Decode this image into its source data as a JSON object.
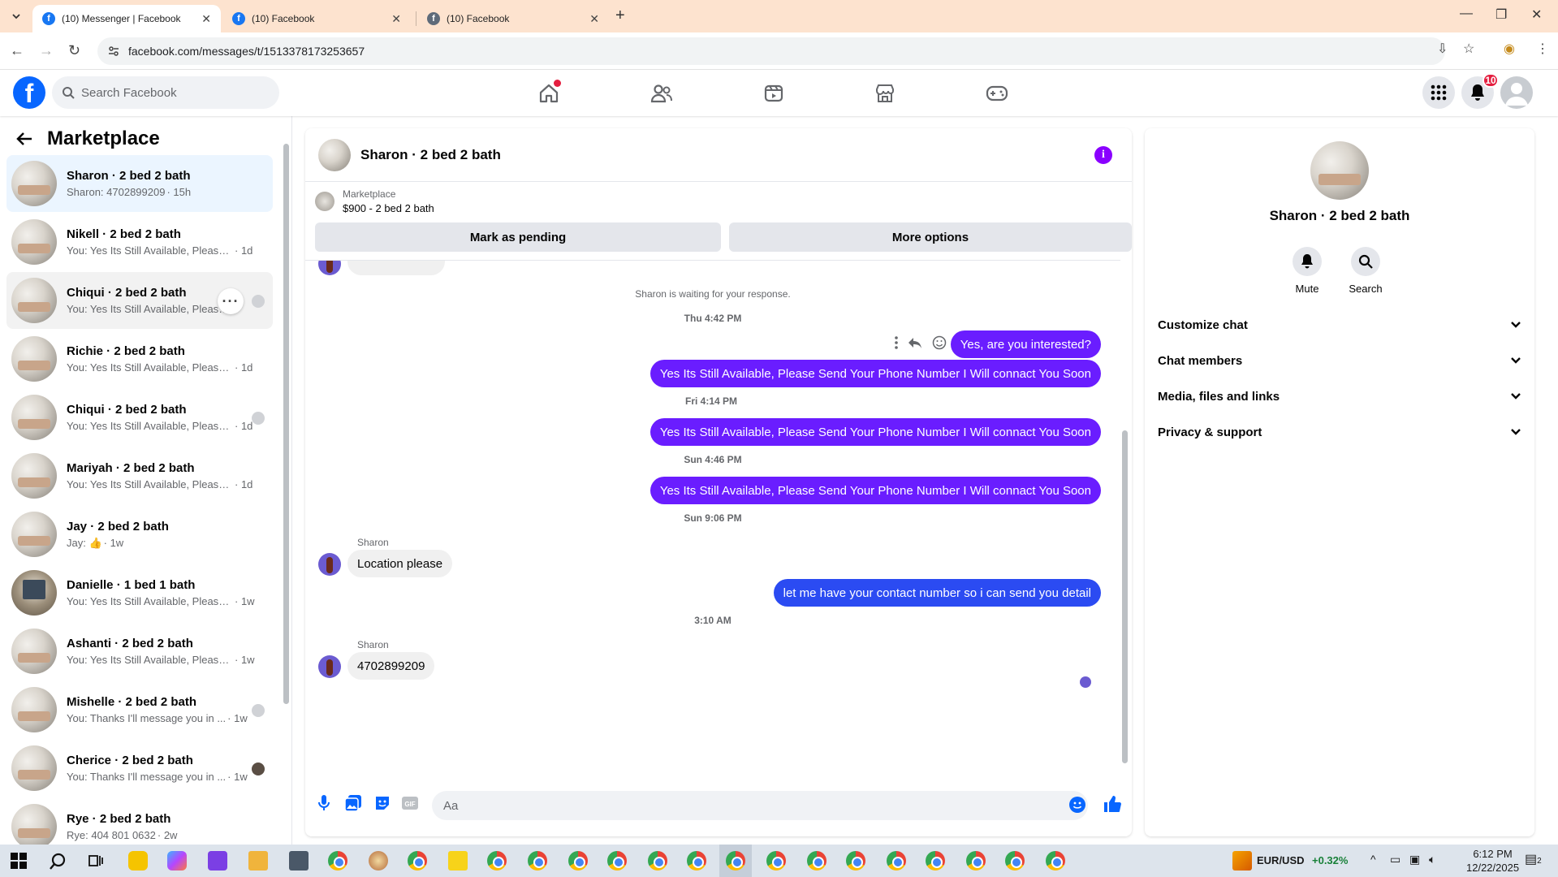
{
  "browser": {
    "tabs": [
      {
        "title": "(10) Messenger | Facebook",
        "active": true
      },
      {
        "title": "(10) Facebook",
        "active": false
      },
      {
        "title": "(10) Facebook",
        "active": false
      }
    ],
    "url": "facebook.com/messages/t/1513378173253657"
  },
  "fb": {
    "search_placeholder": "Search Facebook",
    "notif_count": "10",
    "brand_color": "#0866ff"
  },
  "sidebar": {
    "title": "Marketplace",
    "conversations": [
      {
        "name": "Sharon · 2 bed 2 bath",
        "preview": "Sharon: 4702899209",
        "time": "· 15h",
        "selected": true
      },
      {
        "name": "Nikell · 2 bed 2 bath",
        "preview": "You: Yes Its Still Available, Please Se...",
        "time": "· 1d"
      },
      {
        "name": "Chiqui · 2 bed 2 bath",
        "preview": "You: Yes Its Still Available, Please...",
        "time": "· 1d"
      },
      {
        "name": "Richie · 2 bed 2 bath",
        "preview": "You: Yes Its Still Available, Please Se...",
        "time": "· 1d"
      },
      {
        "name": "Chiqui · 2 bed 2 bath",
        "preview": "You: Yes Its Still Available, Please...",
        "time": "· 1d"
      },
      {
        "name": "Mariyah · 2 bed 2 bath",
        "preview": "You: Yes Its Still Available, Please Se...",
        "time": "· 1d"
      },
      {
        "name": "Jay · 2 bed 2 bath",
        "preview": "Jay: 👍",
        "time": "· 1w"
      },
      {
        "name": "Danielle · 1 bed 1 bath",
        "preview": "You: Yes Its Still Available, Please Se...",
        "time": "· 1w"
      },
      {
        "name": "Ashanti · 2 bed 2 bath",
        "preview": "You: Yes Its Still Available, Please Se...",
        "time": "· 1w"
      },
      {
        "name": "Mishelle · 2 bed 2 bath",
        "preview": "You: Thanks I'll message you in ...",
        "time": "· 1w"
      },
      {
        "name": "Cherice · 2 bed 2 bath",
        "preview": "You: Thanks I'll message you in ...",
        "time": "· 1w"
      },
      {
        "name": "Rye · 2 bed 2 bath",
        "preview": "Rye: 404 801 0632",
        "time": "· 2w"
      }
    ]
  },
  "chat": {
    "title": "Sharon · 2 bed 2 bath",
    "listing_label": "Marketplace",
    "listing_title": "$900 - 2 bed 2 bath",
    "mark_pending": "Mark as pending",
    "more_options": "More options",
    "waiting_notice": "Sharon is waiting for your response.",
    "stamps": [
      "Thu 4:42 PM",
      "Fri 4:14 PM",
      "Sun 4:46 PM",
      "Sun 9:06 PM",
      "3:10 AM"
    ],
    "out_msgs": [
      "Yes, are you interested?",
      "Yes Its Still Available, Please Send Your Phone Number I Will connact You Soon",
      "Yes Its Still Available, Please Send Your Phone Number I Will connact You Soon",
      "Yes Its Still Available, Please Send Your Phone Number I Will connact You Soon",
      "let me have your contact number so i can send you detail"
    ],
    "sender_name": "Sharon",
    "in_msgs": [
      "Location please",
      "4702899209"
    ],
    "composer_placeholder": "Aa",
    "accent": "#6a1dff"
  },
  "info": {
    "name": "Sharon · 2 bed 2 bath",
    "mute": "Mute",
    "search": "Search",
    "sections": [
      "Customize chat",
      "Chat members",
      "Media, files and links",
      "Privacy & support"
    ]
  },
  "taskbar": {
    "ticker": "EUR/USD",
    "ticker_change": "+0.32%",
    "time": "6:12 PM",
    "date": "12/22/2025",
    "notif": "2"
  }
}
